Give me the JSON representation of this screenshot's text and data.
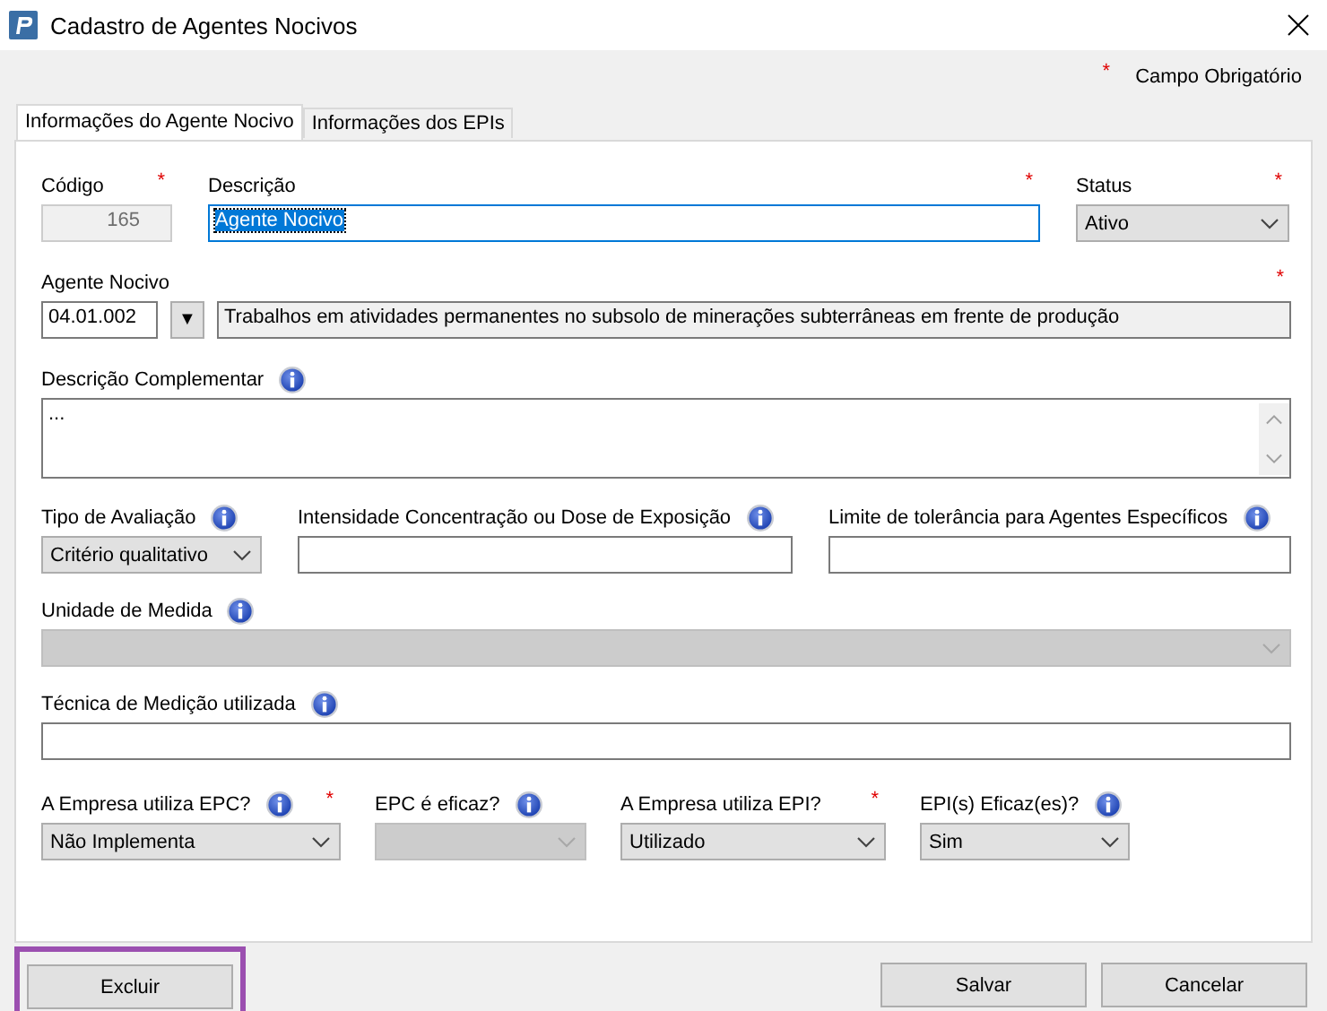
{
  "window": {
    "title": "Cadastro de Agentes Nocivos"
  },
  "required_legend": {
    "marker": "*",
    "text": "Campo Obrigatório"
  },
  "tabs": [
    {
      "label": "Informações do Agente Nocivo",
      "selected": true
    },
    {
      "label": "Informações dos EPIs",
      "selected": false
    }
  ],
  "form_rows": [
    [
      {
        "kind": "text",
        "label": "Código",
        "required": true,
        "info": false,
        "value": "165",
        "disabled": true,
        "text_selected": false
      },
      {
        "kind": "text",
        "label": "Descrição",
        "required": true,
        "info": false,
        "value": "Agente Nocivo",
        "disabled": false,
        "text_selected": true
      },
      {
        "kind": "select",
        "label": "Status",
        "required": true,
        "info": false,
        "value": "Ativo",
        "disabled": false
      }
    ],
    [
      {
        "kind": "lookup",
        "label": "Agente Nocivo",
        "required": true,
        "info": false,
        "code": "04.01.002",
        "button": "▼",
        "description": "Trabalhos em atividades permanentes no subsolo de minerações subterrâneas em frente de produção"
      }
    ],
    [
      {
        "kind": "textarea",
        "label": "Descrição Complementar",
        "required": false,
        "info": true,
        "value": "..."
      }
    ],
    [
      {
        "kind": "select",
        "label": "Tipo de Avaliação",
        "required": false,
        "info": true,
        "value": "Critério qualitativo",
        "disabled": false
      },
      {
        "kind": "text",
        "label": "Intensidade Concentração ou Dose de Exposição",
        "required": false,
        "info": true,
        "disabled": false,
        "text_selected": false
      },
      {
        "kind": "text",
        "label": "Limite de tolerância para Agentes Específicos",
        "required": false,
        "info": true,
        "disabled": false,
        "text_selected": false
      }
    ],
    [
      {
        "kind": "select",
        "label": "Unidade de Medida",
        "required": false,
        "info": true,
        "disabled": true
      }
    ],
    [
      {
        "kind": "text",
        "label": "Técnica de Medição utilizada",
        "required": false,
        "info": true,
        "disabled": false,
        "text_selected": false
      }
    ],
    [
      {
        "kind": "select",
        "label": "A Empresa utiliza EPC?",
        "required": true,
        "info": true,
        "value": "Não Implementa",
        "disabled": false
      },
      {
        "kind": "select",
        "label": "EPC é eficaz?",
        "required": false,
        "info": true,
        "disabled": true
      },
      {
        "kind": "select",
        "label": "A Empresa utiliza EPI?",
        "required": true,
        "info": false,
        "value": "Utilizado",
        "disabled": false
      },
      {
        "kind": "select",
        "label": "EPI(s) Eficaz(es)?",
        "required": false,
        "info": true,
        "value": "Sim",
        "disabled": false
      }
    ]
  ],
  "buttons": [
    {
      "label": "Excluir",
      "highlighted": true
    },
    {
      "label": "Salvar",
      "highlighted": false
    },
    {
      "label": "Cancelar",
      "highlighted": false
    }
  ]
}
